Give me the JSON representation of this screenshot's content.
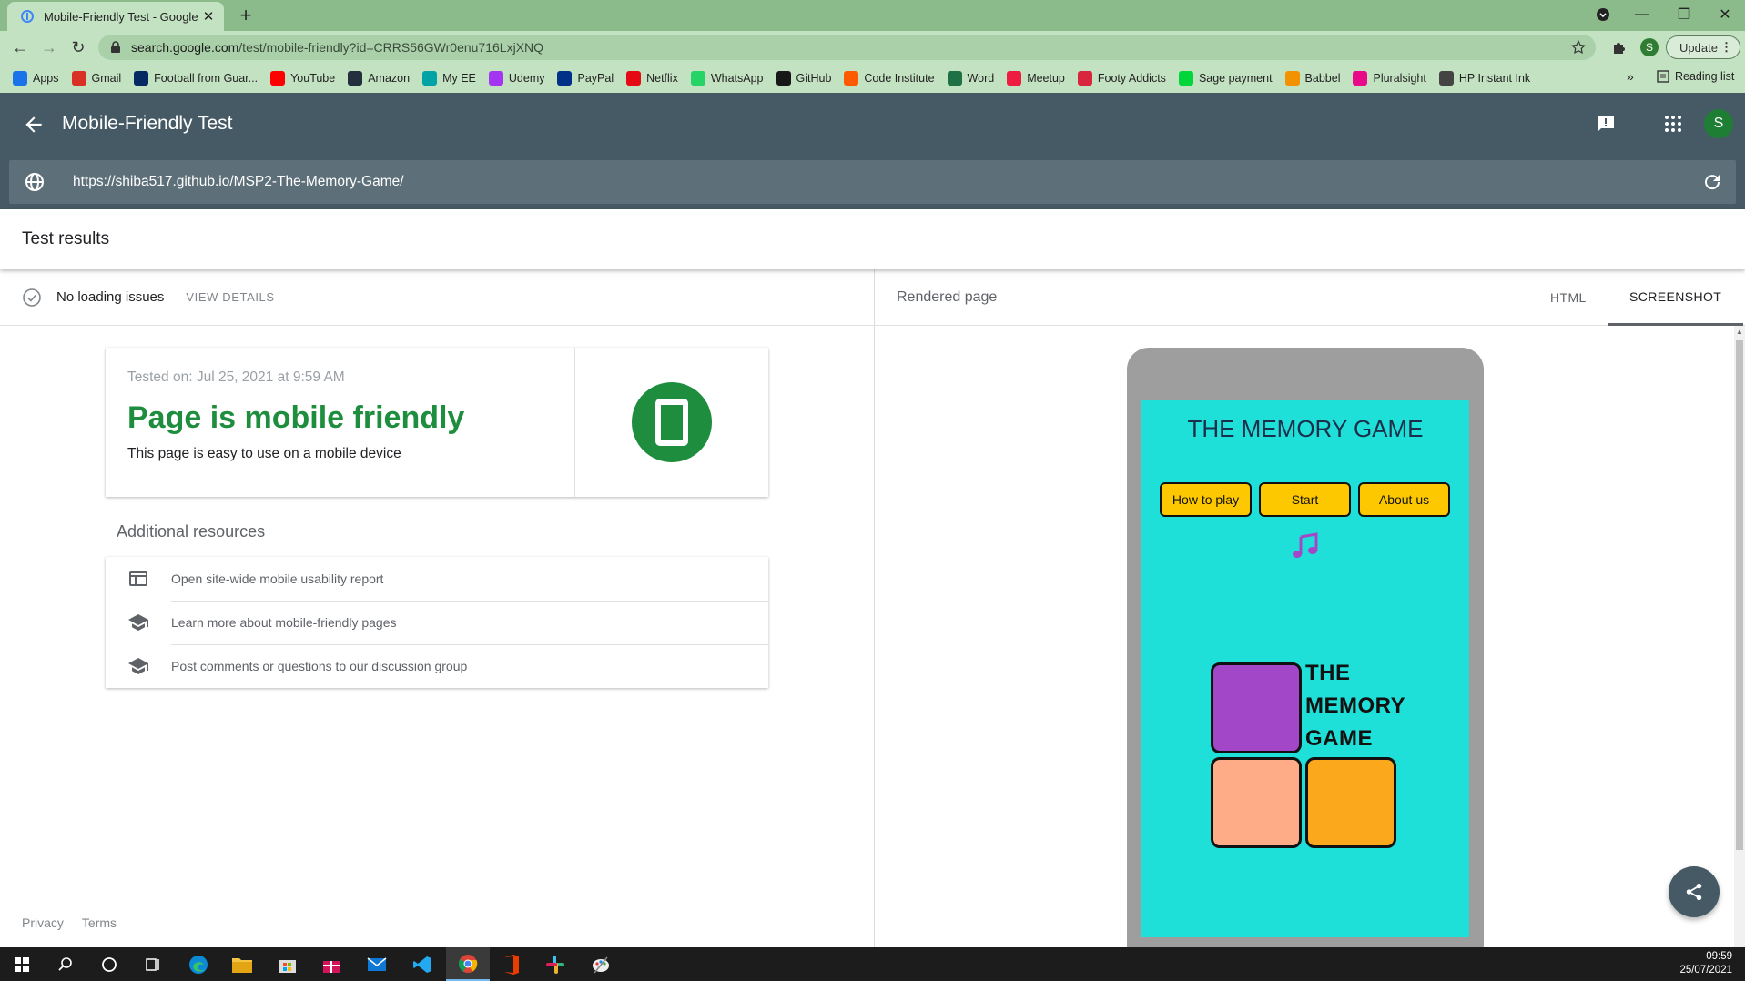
{
  "browser": {
    "tab_title": "Mobile-Friendly Test - Google Se",
    "url_host": "search.google.com",
    "url_path": "/test/mobile-friendly?id=CRRS56GWr0enu716LxjXNQ",
    "profile_initial": "S",
    "update_label": "Update",
    "bookmarks": [
      {
        "label": "Apps",
        "icon": "apps-grid-icon",
        "color": "#1a73e8"
      },
      {
        "label": "Gmail",
        "icon": "gmail-icon",
        "color": "#d93025"
      },
      {
        "label": "Football from Guar...",
        "icon": "guardian-icon",
        "color": "#052962"
      },
      {
        "label": "YouTube",
        "icon": "youtube-icon",
        "color": "#ff0000"
      },
      {
        "label": "Amazon",
        "icon": "amazon-icon",
        "color": "#232f3e"
      },
      {
        "label": "My EE",
        "icon": "ee-icon",
        "color": "#00a3a5"
      },
      {
        "label": "Udemy",
        "icon": "udemy-icon",
        "color": "#a435f0"
      },
      {
        "label": "PayPal",
        "icon": "paypal-icon",
        "color": "#003087"
      },
      {
        "label": "Netflix",
        "icon": "netflix-icon",
        "color": "#e50914"
      },
      {
        "label": "WhatsApp",
        "icon": "whatsapp-icon",
        "color": "#25d366"
      },
      {
        "label": "GitHub",
        "icon": "github-icon",
        "color": "#181717"
      },
      {
        "label": "Code Institute",
        "icon": "code-institute-icon",
        "color": "#ff5a00"
      },
      {
        "label": "Word",
        "icon": "word-icon",
        "color": "#1e7145"
      },
      {
        "label": "Meetup",
        "icon": "meetup-icon",
        "color": "#ed1c40"
      },
      {
        "label": "Footy Addicts",
        "icon": "footy-addicts-icon",
        "color": "#d7263d"
      },
      {
        "label": "Sage payment",
        "icon": "sage-icon",
        "color": "#00d639"
      },
      {
        "label": "Babbel",
        "icon": "babbel-icon",
        "color": "#f39200"
      },
      {
        "label": "Pluralsight",
        "icon": "pluralsight-icon",
        "color": "#e80a89"
      },
      {
        "label": "HP Instant Ink",
        "icon": "hp-icon",
        "color": "#444444"
      }
    ],
    "reading_list_label": "Reading list"
  },
  "app": {
    "title": "Mobile-Friendly Test",
    "tested_url": "https://shiba517.github.io/MSP2-The-Memory-Game/",
    "avatar_initial": "S",
    "header_color": "#455a64"
  },
  "results": {
    "title": "Test results",
    "status": "No loading issues",
    "view_details": "VIEW DETAILS",
    "tested_on": "Tested on: Jul 25, 2021 at 9:59 AM",
    "verdict": "Page is mobile friendly",
    "verdict_sub": "This page is easy to use on a mobile device",
    "verdict_color": "#1e8e3e"
  },
  "resources": {
    "title": "Additional resources",
    "items": [
      {
        "label": "Open site-wide mobile usability report",
        "icon": "report-icon"
      },
      {
        "label": "Learn more about mobile-friendly pages",
        "icon": "school-icon"
      },
      {
        "label": "Post comments or questions to our discussion group",
        "icon": "school-icon"
      }
    ]
  },
  "footer": {
    "privacy": "Privacy",
    "terms": "Terms"
  },
  "rendered": {
    "label": "Rendered page",
    "tabs": [
      "HTML",
      "SCREENSHOT"
    ],
    "active_tab": "SCREENSHOT",
    "game": {
      "title": "THE MEMORY GAME",
      "buttons": [
        "How to play",
        "Start",
        "About us"
      ],
      "logo_lines": [
        "THE",
        "MEMORY",
        "GAME"
      ],
      "background": "#1fe0d8",
      "button_color": "#fdc800",
      "tile_colors": [
        "#a347c9",
        "#fdac87",
        "#fba81c"
      ]
    }
  },
  "taskbar": {
    "time": "09:59",
    "date": "25/07/2021"
  }
}
